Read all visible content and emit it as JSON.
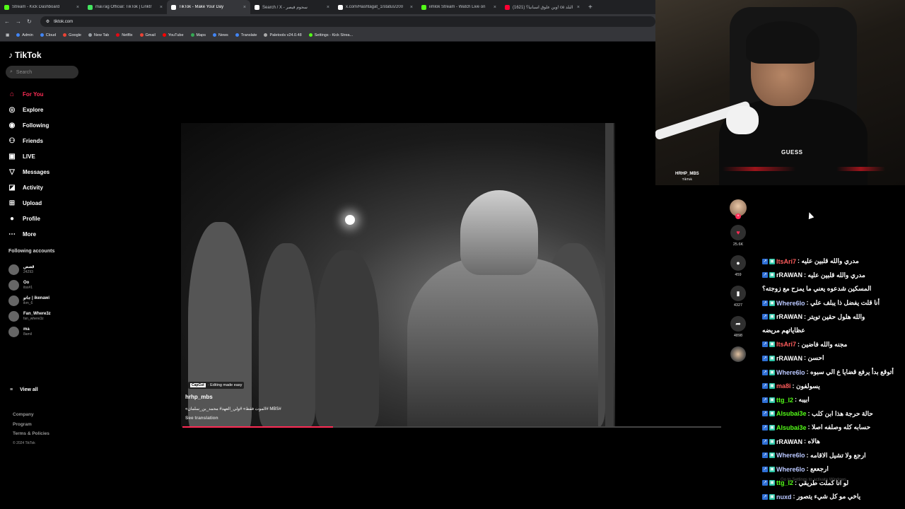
{
  "browser": {
    "tabs": [
      {
        "title": "Stream - Kick Dashboard",
        "color": "#53fc18",
        "active": false
      },
      {
        "title": "mai7ag Official: TikTok | Linktr",
        "color": "#43e660",
        "active": false
      },
      {
        "title": "TikTok - Make Your Day",
        "color": "#ffffff",
        "active": true
      },
      {
        "title": "Search / X - سحوم فيصر",
        "color": "#ffffff",
        "active": false
      },
      {
        "title": "x.com/Hashtagat_1/status/200",
        "color": "#ffffff",
        "active": false
      },
      {
        "title": "iimlok Stream - Watch Live on",
        "color": "#53fc18",
        "active": false
      },
      {
        "title": "(1621) وين علوق اسبانيا؟! ce البلد",
        "color": "#ff0033",
        "active": false
      }
    ],
    "url": "tiktok.com",
    "bookmarks": [
      "Admin",
      "Cloud",
      "Google",
      "New Tab",
      "Netflix",
      "Gmail",
      "YouTube",
      "Maps",
      "News",
      "Translate",
      "Paletools v24.0.48",
      "Settings - Kick Strea..."
    ]
  },
  "tiktok": {
    "logo": "TikTok",
    "search_placeholder": "Search",
    "nav": [
      {
        "label": "For You",
        "icon": "home-icon",
        "glyph": "⌂"
      },
      {
        "label": "Explore",
        "icon": "compass-icon",
        "glyph": "◎"
      },
      {
        "label": "Following",
        "icon": "following-icon",
        "glyph": "◉"
      },
      {
        "label": "Friends",
        "icon": "friends-icon",
        "glyph": "⚇"
      },
      {
        "label": "LIVE",
        "icon": "live-icon",
        "glyph": "▣"
      },
      {
        "label": "Messages",
        "icon": "messages-icon",
        "glyph": "▽"
      },
      {
        "label": "Activity",
        "icon": "activity-icon",
        "glyph": "◪"
      },
      {
        "label": "Upload",
        "icon": "upload-icon",
        "glyph": "⊞"
      },
      {
        "label": "Profile",
        "icon": "profile-icon",
        "glyph": "●"
      },
      {
        "label": "More",
        "icon": "more-icon",
        "glyph": "⋯"
      }
    ],
    "following_title": "Following accounts",
    "following": [
      {
        "name": "قصص",
        "handle": "24293"
      },
      {
        "name": "Oo",
        "handle": "itss#1"
      },
      {
        "name": "جاتو | ikenawi",
        "handle": "ikm_6"
      },
      {
        "name": "Fan_Where3z",
        "handle": "fan_where3z"
      },
      {
        "name": "ma",
        "handle": "8amil"
      }
    ],
    "view_all": "View all",
    "footer": [
      "Company",
      "Program",
      "Terms & Policies"
    ],
    "copyright": "© 2024 TikTok",
    "video": {
      "capcut_logo": "CapCut",
      "capcut_text": "· Editing made easy",
      "author": "hrhp_mbs",
      "caption": "«الموت فقط» #ولي_العهد# محمد_بن_سلمان# MBS#",
      "see_translation": "See translation",
      "progress_fraction": 0.28
    },
    "actions": {
      "likes": "25.6K",
      "comments": "459",
      "saves": "4327",
      "shares": "4898"
    }
  },
  "webcam": {
    "brand": "GUESS",
    "watermark": "HRHP_MBS",
    "watermark_sub": "TikTok"
  },
  "chat": [
    {
      "user": "ItsAri7",
      "color": "#ff5c5c",
      "text": ": مدري والله قلبين عليه"
    },
    {
      "user": "rRAWAN",
      "color": "#ffffff",
      "text": ": مدري والله قلبين عليه"
    },
    {
      "user": "",
      "color": "#ffffff",
      "text": "المسكين شدعوه يعني ما يمزح مع زوجته؟"
    },
    {
      "user": "Where6lo",
      "color": "#b9c7ff",
      "text": ": أنا قلت يفضل ذا يبلف علي"
    },
    {
      "user": "rRAWAN",
      "color": "#ffffff",
      "text": ": والله هلول حقين تويتر"
    },
    {
      "user": "",
      "color": "#ffffff",
      "text": "عظاياتهم مريضه"
    },
    {
      "user": "ItsAri7",
      "color": "#ff5c5c",
      "text": ": مجنه والله فاضين"
    },
    {
      "user": "rRAWAN",
      "color": "#ffffff",
      "text": ": احسن"
    },
    {
      "user": "Where6lo",
      "color": "#b9c7ff",
      "text": ": أتوقع بدأ يرفع قضايا ع الي سبوه"
    },
    {
      "user": "ma8i",
      "color": "#ff5c5c",
      "text": ": يسولفون"
    },
    {
      "user": "ttg_l2",
      "color": "#53fc18",
      "text": ": ابيبه"
    },
    {
      "user": "Alsubai3e",
      "color": "#53fc18",
      "text": ": حالة حرجة هذا ابن كلب"
    },
    {
      "user": "Alsubai3e",
      "color": "#53fc18",
      "text": ": حسابه كله وصلفه اصلا"
    },
    {
      "user": "rRAWAN",
      "color": "#ffffff",
      "text": ": هالاه"
    },
    {
      "user": "Where6lo",
      "color": "#b9c7ff",
      "text": ": ارجع ولا تشيل الاقامه"
    },
    {
      "user": "Where6lo",
      "color": "#b9c7ff",
      "text": ": ارجععع"
    },
    {
      "user": "ttg_l2",
      "color": "#53fc18",
      "text": ": لو انا كملت طريقي"
    },
    {
      "user": "nuxd",
      "color": "#b9c7ff",
      "text": ": ياخي مو كل شيء يتصور"
    }
  ],
  "activate_windows": "Go to Settings to activate Windows."
}
